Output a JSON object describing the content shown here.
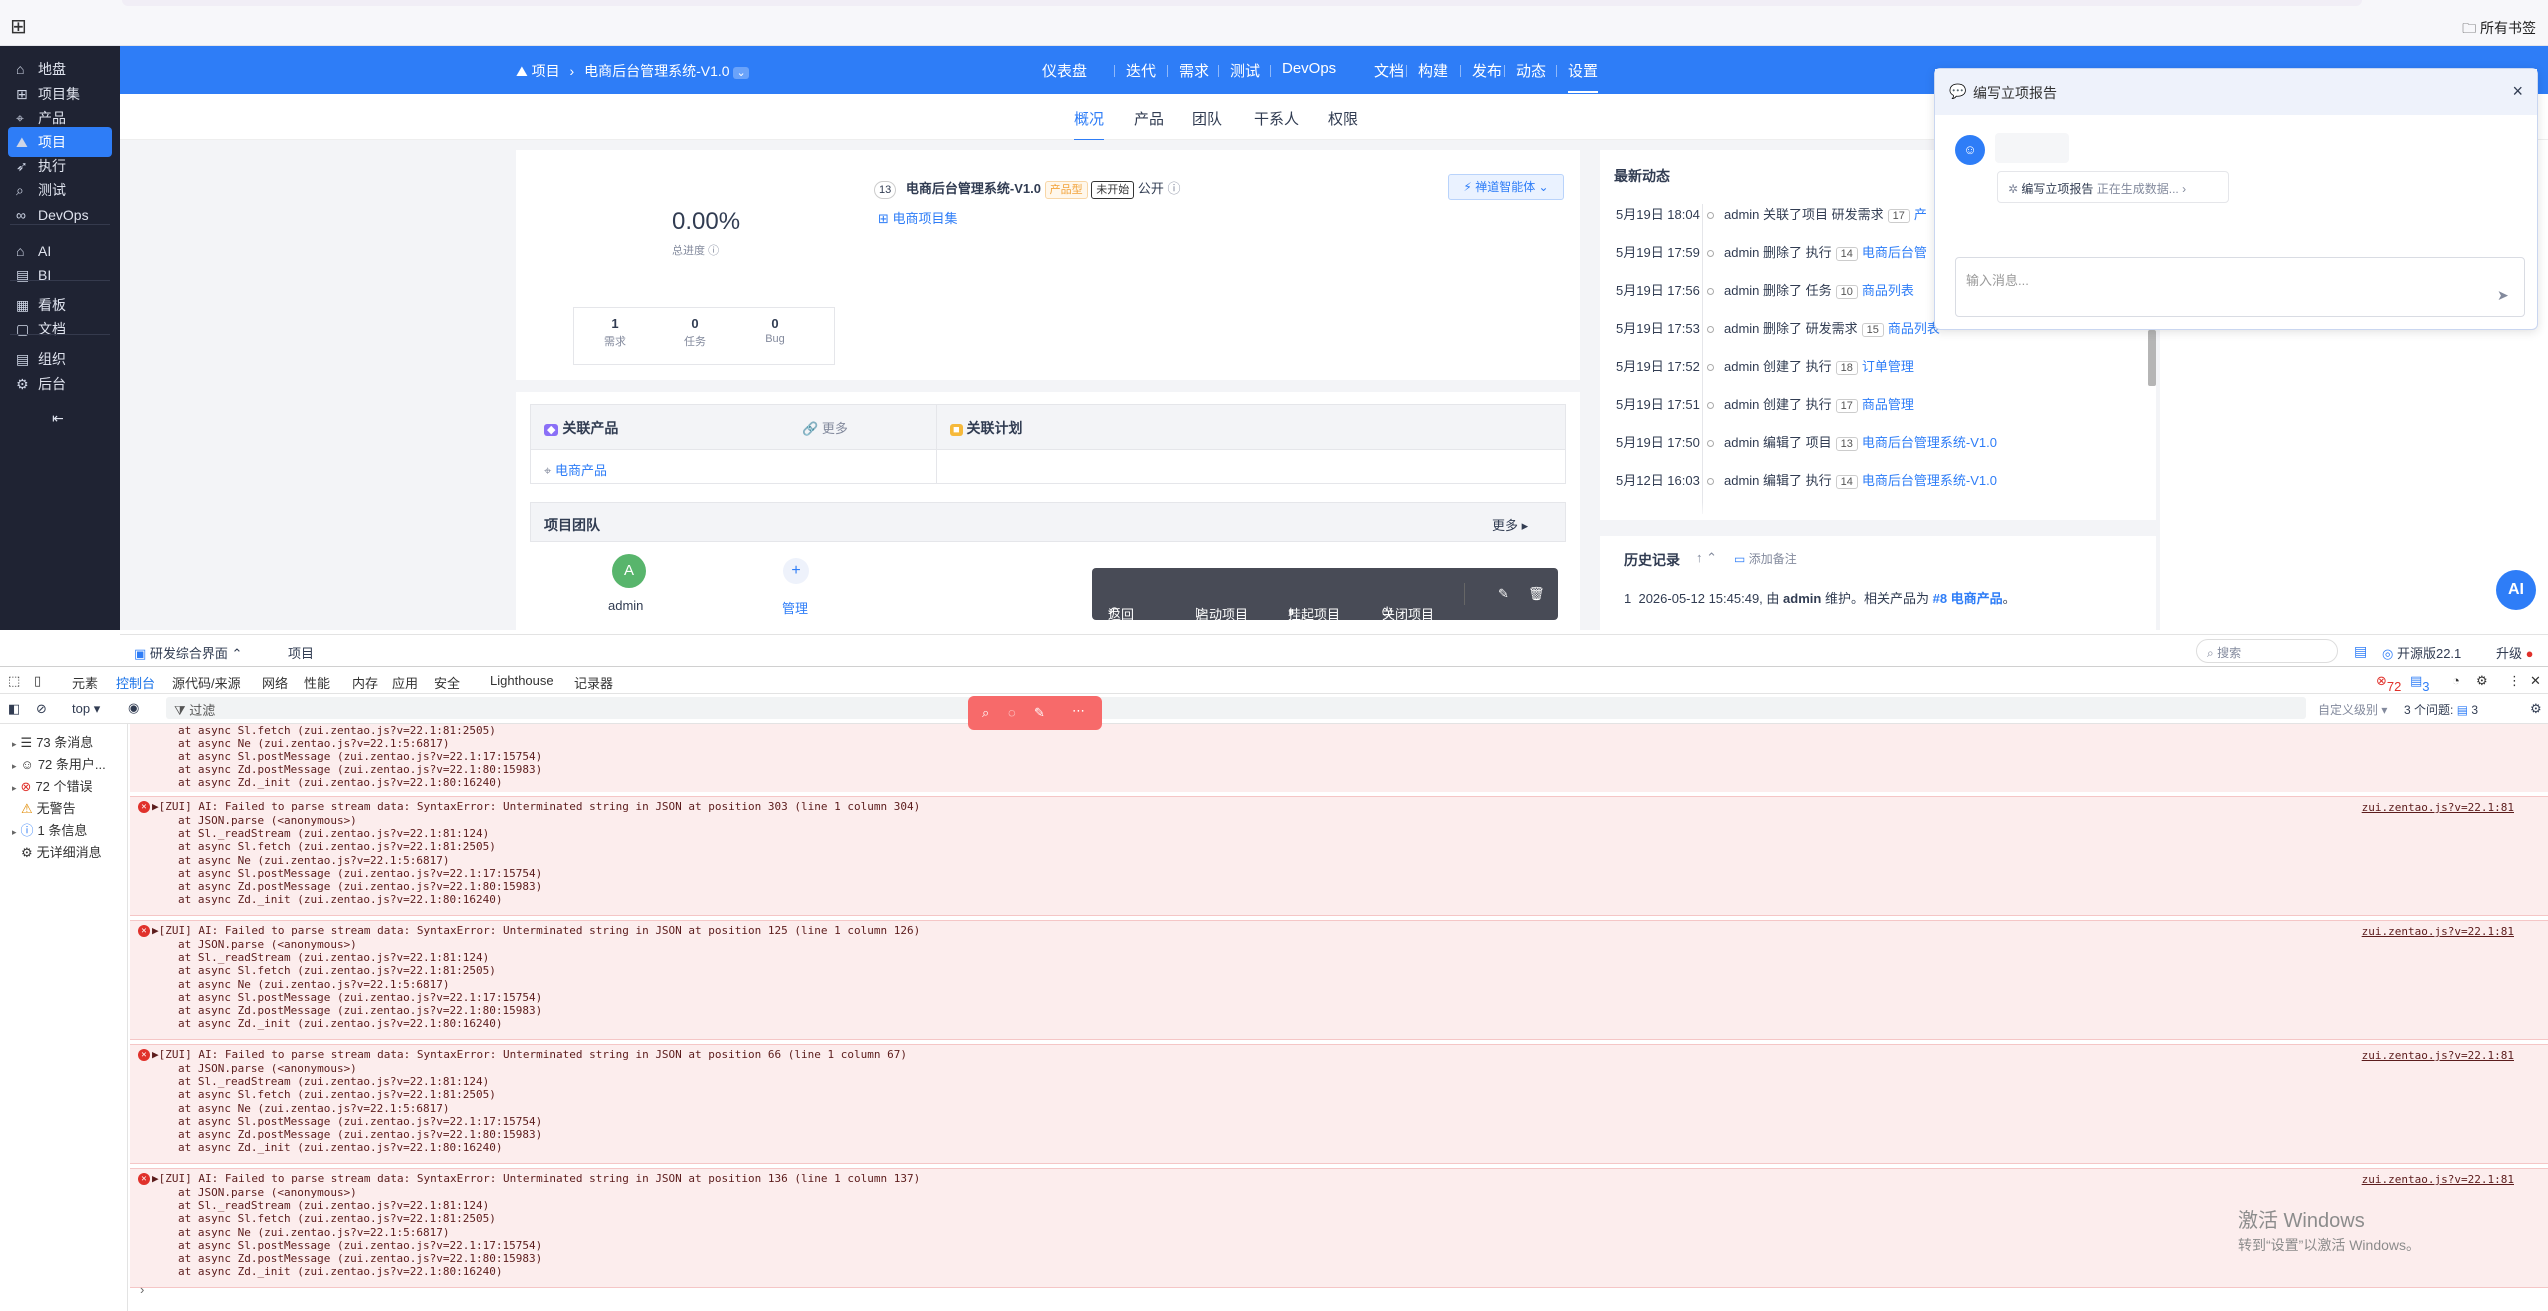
{
  "browser": {
    "bookmarks": "所有书签"
  },
  "sidebar": {
    "items": [
      {
        "label": "地盘",
        "icon": "home-icon"
      },
      {
        "label": "项目集",
        "icon": "grid-icon"
      },
      {
        "label": "产品",
        "icon": "location-icon"
      },
      {
        "label": "项目",
        "icon": "project-icon"
      },
      {
        "label": "执行",
        "icon": "rocket-icon"
      },
      {
        "label": "测试",
        "icon": "search-icon"
      },
      {
        "label": "DevOps",
        "icon": "infinity-icon"
      },
      {
        "label": "AI",
        "icon": "ai-icon"
      },
      {
        "label": "BI",
        "icon": "bi-icon"
      },
      {
        "label": "看板",
        "icon": "board-icon"
      },
      {
        "label": "文档",
        "icon": "doc-icon"
      },
      {
        "label": "组织",
        "icon": "org-icon"
      },
      {
        "label": "后台",
        "icon": "gear-icon"
      }
    ]
  },
  "topbar": {
    "crumb_root": "项目",
    "crumb_project": "电商后台管理系统-V1.0",
    "nav": [
      "仪表盘",
      "迭代",
      "需求",
      "测试",
      "DevOps",
      "文档",
      "构建",
      "发布",
      "动态",
      "设置"
    ],
    "active": "设置"
  },
  "subnav": {
    "tabs": [
      "概况",
      "产品",
      "团队",
      "干系人",
      "权限"
    ],
    "active": "概况"
  },
  "overview": {
    "progress": "0.00%",
    "progress_label": "总进度",
    "stats": [
      {
        "value": "1",
        "label": "需求"
      },
      {
        "value": "0",
        "label": "任务"
      },
      {
        "value": "0",
        "label": "Bug"
      }
    ],
    "id": "13",
    "name": "电商后台管理系统-V1.0",
    "tag_type": "产品型",
    "tag_status": "未开始",
    "visibility": "公开",
    "program": "电商项目集",
    "ai_button": "禅道智能体"
  },
  "related": {
    "products_title": "关联产品",
    "more": "更多",
    "plans_title": "关联计划",
    "product": "电商产品"
  },
  "team": {
    "title": "项目团队",
    "more": "更多",
    "member_initial": "A",
    "member_name": "admin",
    "manage": "管理"
  },
  "feed": {
    "title": "最新动态",
    "rows": [
      {
        "time": "5月19日 18:04",
        "text": "admin 关联了项目 研发需求",
        "num": "17",
        "link": "产"
      },
      {
        "time": "5月19日 17:59",
        "text": "admin 删除了 执行",
        "num": "14",
        "link": "电商后台管"
      },
      {
        "time": "5月19日 17:56",
        "text": "admin 删除了 任务",
        "num": "10",
        "link": "商品列表"
      },
      {
        "time": "5月19日 17:53",
        "text": "admin 删除了 研发需求",
        "num": "15",
        "link": "商品列表"
      },
      {
        "time": "5月19日 17:52",
        "text": "admin 创建了 执行",
        "num": "18",
        "link": "订单管理"
      },
      {
        "time": "5月19日 17:51",
        "text": "admin 创建了 执行",
        "num": "17",
        "link": "商品管理"
      },
      {
        "time": "5月19日 17:50",
        "text": "admin 编辑了 项目",
        "num": "13",
        "link": "电商后台管理系统-V1.0"
      },
      {
        "time": "5月12日 16:03",
        "text": "admin 编辑了 执行",
        "num": "14",
        "link": "电商后台管理系统-V1.0"
      }
    ]
  },
  "history": {
    "title": "历史记录",
    "add_note": "添加备注",
    "entry1_prefix": "2026-05-12 15:45:49, 由",
    "entry1_user": "admin",
    "entry1_text": "维护。相关产品为",
    "entry1_link": "#8 电商产品",
    "entry1_suffix": "。"
  },
  "toolbar": {
    "buttons": [
      "返回",
      "启动项目",
      "挂起项目",
      "关闭项目"
    ]
  },
  "chat": {
    "title": "编写立项报告",
    "task": "编写立项报告",
    "status": "正在生成数据...",
    "input_placeholder": "输入消息..."
  },
  "ai_fab": "AI",
  "bottombar": {
    "app": "研发综合界面",
    "tab": "项目",
    "search_placeholder": "搜索",
    "version": "开源版22.1",
    "upgrade": "升级"
  },
  "devtools": {
    "tabs": [
      "元素",
      "控制台",
      "源代码/来源",
      "网络",
      "性能",
      "内存",
      "应用",
      "安全",
      "Lighthouse",
      "记录器"
    ],
    "active": "控制台",
    "errors": "72",
    "warnings": "3",
    "context": "top",
    "filter_placeholder": "过滤",
    "level": "自定义级别",
    "issues": "3 个问题:",
    "issues_count": "3",
    "side": [
      "73 条消息",
      "72 条用户...",
      "72 个错误",
      "无警告",
      "1 条信息",
      "无详细消息"
    ]
  },
  "console": {
    "top_lines": [
      "at async Sl.fetch (zui.zentao.js?v=22.1:81:2505)",
      "at async Ne (zui.zentao.js?v=22.1:5:6817)",
      "at async Sl.postMessage (zui.zentao.js?v=22.1:17:15754)",
      "at async Zd.postMessage (zui.zentao.js?v=22.1:80:15983)",
      "at async Zd._init (zui.zentao.js?v=22.1:80:16240)"
    ],
    "errors": [
      {
        "msg": "▶[ZUI] AI: Failed to parse stream data: SyntaxError: Unterminated string in JSON at position 303 (line 1 column 304)"
      },
      {
        "msg": "▶[ZUI] AI: Failed to parse stream data: SyntaxError: Unterminated string in JSON at position 125 (line 1 column 126)"
      },
      {
        "msg": "▶[ZUI] AI: Failed to parse stream data: SyntaxError: Unterminated string in JSON at position 66 (line 1 column 67)"
      },
      {
        "msg": "▶[ZUI] AI: Failed to parse stream data: SyntaxError: Unterminated string in JSON at position 136 (line 1 column 137)"
      }
    ],
    "stack": [
      "at JSON.parse (<anonymous>)",
      "at Sl._readStream (zui.zentao.js?v=22.1:81:124)",
      "at async Sl.fetch (zui.zentao.js?v=22.1:81:2505)",
      "at async Ne (zui.zentao.js?v=22.1:5:6817)",
      "at async Sl.postMessage (zui.zentao.js?v=22.1:17:15754)",
      "at async Zd.postMessage (zui.zentao.js?v=22.1:80:15983)",
      "at async Zd._init (zui.zentao.js?v=22.1:80:16240)"
    ],
    "source": "zui.zentao.js?v=22.1:81"
  },
  "windows": {
    "line1": "激活 Windows",
    "line2": "转到“设置”以激活 Windows。"
  }
}
